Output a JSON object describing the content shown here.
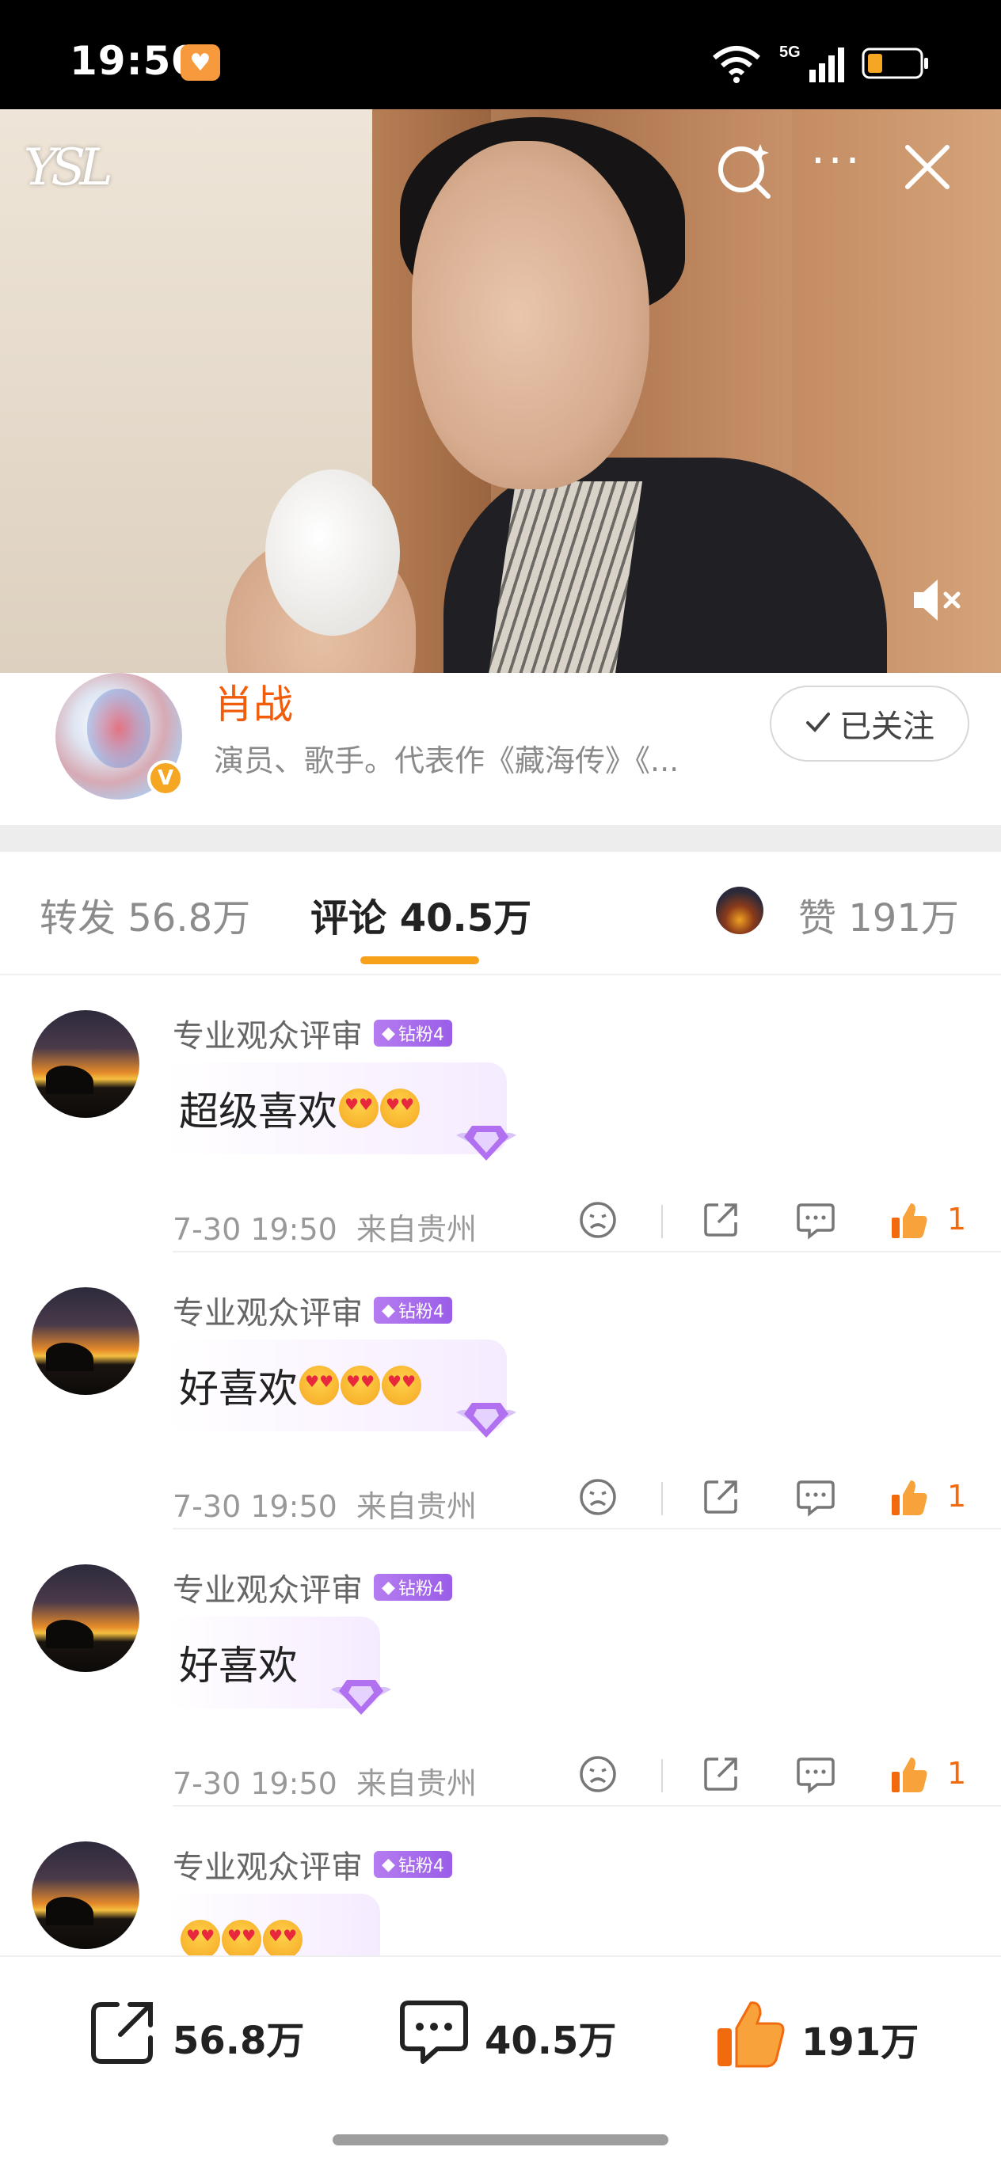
{
  "status_bar": {
    "time": "19:50",
    "network": "5G",
    "icons": [
      "app-notification-icon",
      "wifi-icon",
      "signal-icon",
      "battery-icon"
    ]
  },
  "video": {
    "brand_logo": "YSL",
    "icons": [
      "search-icon",
      "more-icon",
      "close-icon",
      "mute-icon"
    ]
  },
  "profile": {
    "name": "肖战",
    "description": "演员、歌手。代表作《藏海传》《...",
    "verified_mark": "V",
    "follow_label": "已关注"
  },
  "tabs": {
    "repost": "转发 56.8万",
    "comments": "评论 40.5万",
    "likes": "赞 191万"
  },
  "comments": [
    {
      "username": "专业观众评审",
      "badge": "钻粉4",
      "text": "超级喜欢",
      "emoji_count": 2,
      "time": "7-30 19:50",
      "location": "来自贵州",
      "likes": "1"
    },
    {
      "username": "专业观众评审",
      "badge": "钻粉4",
      "text": "好喜欢",
      "emoji_count": 3,
      "time": "7-30 19:50",
      "location": "来自贵州",
      "likes": "1"
    },
    {
      "username": "专业观众评审",
      "badge": "钻粉4",
      "text": "好喜欢",
      "emoji_count": 0,
      "time": "7-30 19:50",
      "location": "来自贵州",
      "likes": "1"
    },
    {
      "username": "专业观众评审",
      "badge": "钻粉4",
      "text": "",
      "emoji_count": 3
    }
  ],
  "bottom_bar": {
    "repost_count": "56.8万",
    "comment_count": "40.5万",
    "like_count": "191万"
  },
  "colors": {
    "accent_orange": "#f25d0c",
    "tab_underline": "#f7a11a",
    "fan_badge": "#a66ff0",
    "like_orange": "#f26a0e"
  }
}
